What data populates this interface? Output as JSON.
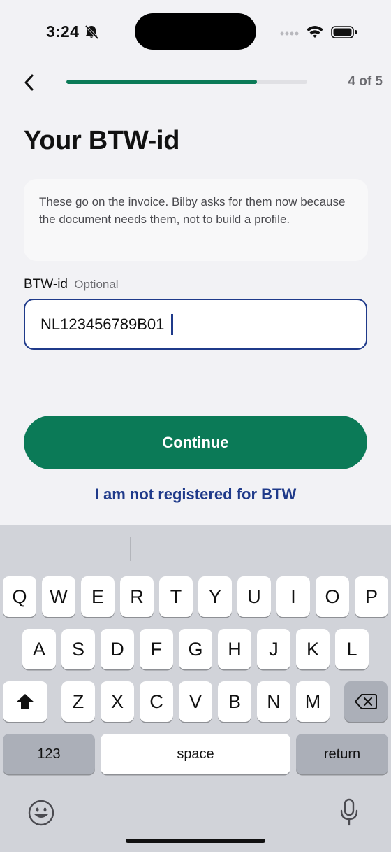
{
  "status_bar": {
    "time": "3:24",
    "icons": [
      "bell-slash-icon",
      "signal-icon",
      "wifi-icon",
      "battery-icon"
    ]
  },
  "nav": {
    "back_icon": "chevron-left-icon",
    "progress": 0.79,
    "step_counter": "4 of 5"
  },
  "page": {
    "title": "Your BTW-id",
    "info_text": "These go on the invoice. Bilby asks for them now because the document needs them, not to build a profile."
  },
  "field": {
    "label": "BTW-id",
    "optional_label": "Optional",
    "value": "NL123456789B01"
  },
  "actions": {
    "continue_label": "Continue",
    "not_registered_label": "I am not registered for BTW"
  },
  "keyboard": {
    "row1": [
      "Q",
      "W",
      "E",
      "R",
      "T",
      "Y",
      "U",
      "I",
      "O",
      "P"
    ],
    "row2": [
      "A",
      "S",
      "D",
      "F",
      "G",
      "H",
      "J",
      "K",
      "L"
    ],
    "row3": [
      "Z",
      "X",
      "C",
      "V",
      "B",
      "N",
      "M"
    ],
    "numbers_label": "123",
    "space_label": "space",
    "return_label": "return",
    "shift_icon": "shift-icon",
    "delete_icon": "delete-icon",
    "emoji_icon": "emoji-icon",
    "mic_icon": "microphone-icon"
  },
  "colors": {
    "accent_green": "#0b7a57",
    "link_blue": "#1f3a8a",
    "background": "#f2f2f5",
    "keyboard_bg": "#d1d3d9"
  }
}
